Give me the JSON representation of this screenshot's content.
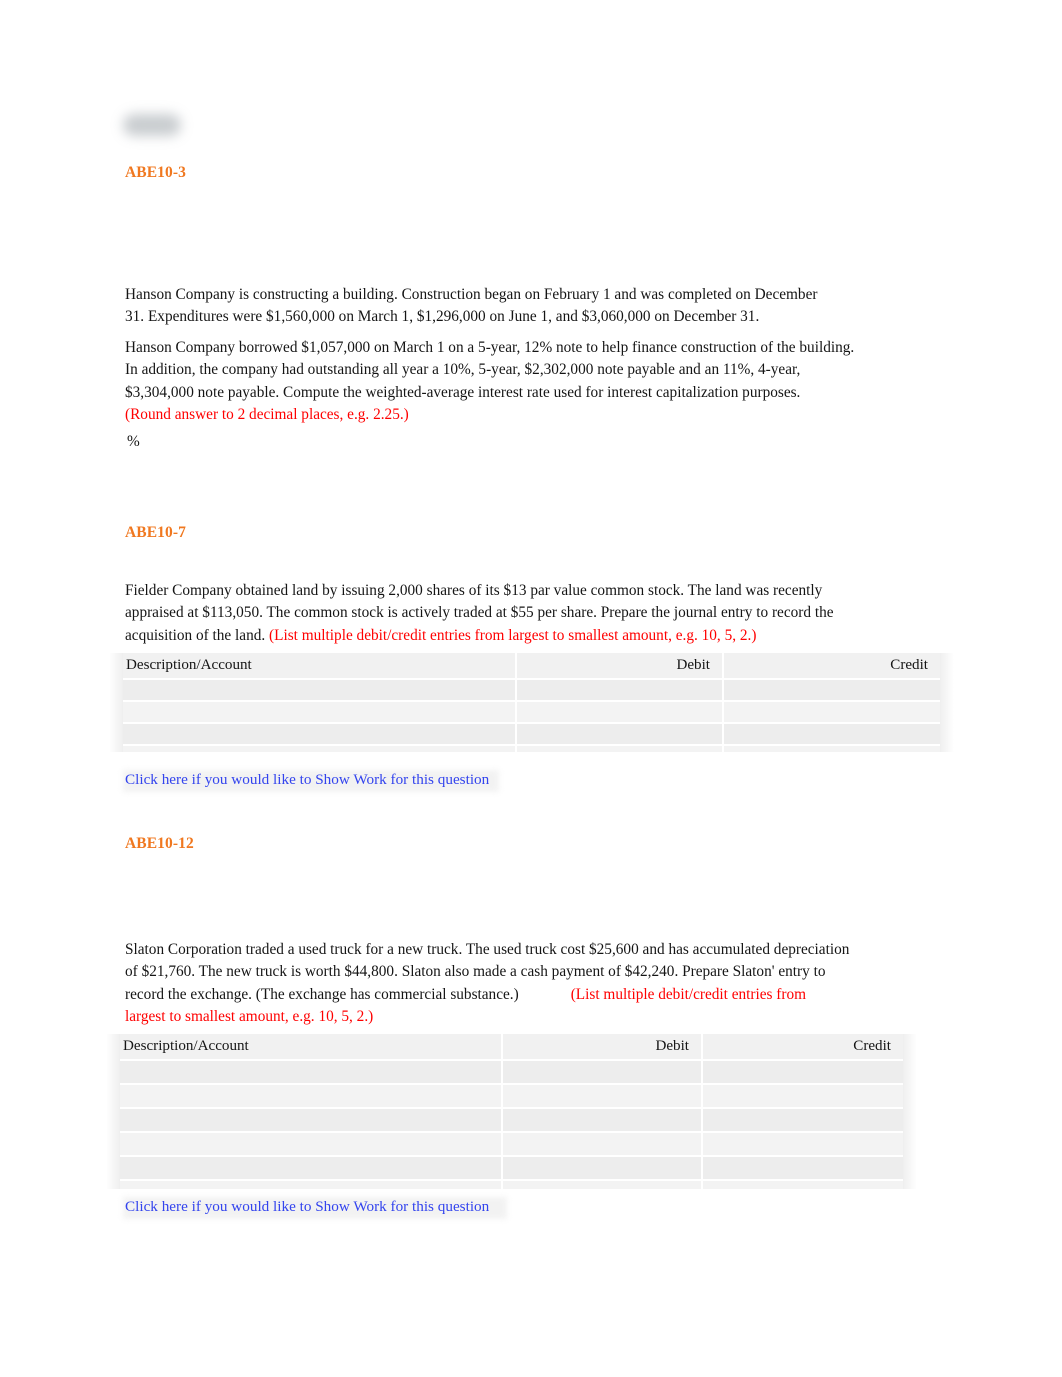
{
  "document": {
    "title": "Accounting Homework Worksheet",
    "redacted_header": ""
  },
  "colors": {
    "heading_orange": "#F07820",
    "instruction_red": "#FF0000",
    "link_blue": "#3344EE",
    "table_row_gray": "#EDEDED",
    "page_background": "#FFFFFF"
  },
  "sections": [
    {
      "id": "abe10-3",
      "heading": "ABE10-3",
      "paragraphs": [
        {
          "text": "Hanson Company is constructing a building. Construction began on February 1 and was completed on December 31. Expenditures were $1,560,000 on March 1, $1,296,000 on June 1, and $3,060,000 on December 31."
        },
        {
          "text": "Hanson Company borrowed $1,057,000 on March 1 on a 5-year, 12% note to help finance construction of the building. In addition, the company had outstanding all year a 10%, 5-year, $2,302,000 note payable and an 11%, 4-year, $3,304,000 note payable. Compute the weighted-average interest rate used for interest capitalization purposes.",
          "instruction": "(Round answer to 2 decimal places, e.g. 2.25.)"
        }
      ],
      "answer_unit": "%"
    },
    {
      "id": "abe10-7",
      "heading": "ABE10-7",
      "paragraphs": [
        {
          "text": "Fielder Company obtained land by issuing 2,000 shares of its $13 par value common stock. The land was recently appraised at $113,050. The common stock is actively traded at $55 per share. Prepare the journal entry to record the acquisition of the land.",
          "instruction": "(List multiple debit/credit entries from largest to smallest amount, e.g. 10, 5, 2.)"
        }
      ],
      "table": {
        "columns": [
          "Description/Account",
          "Debit",
          "Credit"
        ],
        "rows": [
          [
            "",
            "",
            ""
          ],
          [
            "",
            "",
            ""
          ],
          [
            "",
            "",
            ""
          ]
        ]
      },
      "show_work_link": "Click here if you would like to Show Work for this question"
    },
    {
      "id": "abe10-12",
      "heading": "ABE10-12",
      "paragraphs": [
        {
          "text": "Slaton Corporation traded a used truck for a new truck. The used truck cost $25,600 and has accumulated depreciation of $21,760. The new truck is worth $44,800. Slaton also made a cash payment of $42,240. Prepare Slaton' entry to record the exchange. (The exchange has commercial substance.)",
          "instruction": "(List multiple debit/credit entries from largest to smallest amount, e.g. 10, 5, 2.)"
        }
      ],
      "table": {
        "columns": [
          "Description/Account",
          "Debit",
          "Credit"
        ],
        "rows": [
          [
            "",
            "",
            ""
          ],
          [
            "",
            "",
            ""
          ],
          [
            "",
            "",
            ""
          ],
          [
            "",
            "",
            ""
          ],
          [
            "",
            "",
            ""
          ]
        ]
      },
      "show_work_link": "Click here if you would like to Show Work for this question"
    }
  ]
}
